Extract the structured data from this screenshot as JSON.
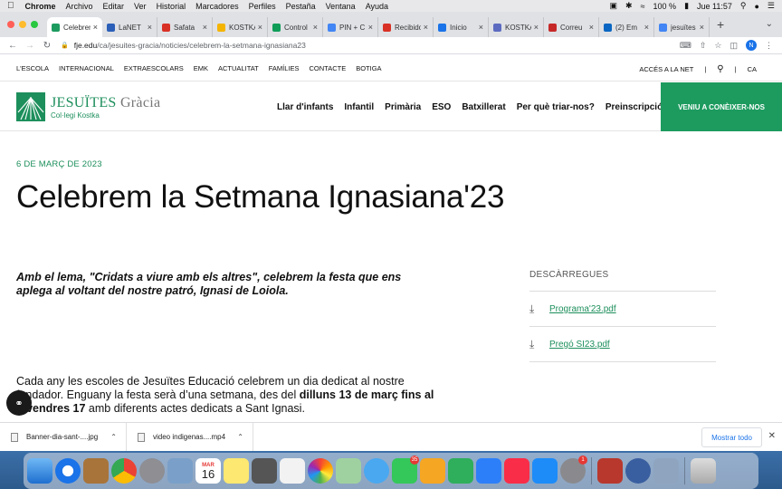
{
  "menubar": {
    "app": "Chrome",
    "items": [
      "Archivo",
      "Editar",
      "Ver",
      "Historial",
      "Marcadores",
      "Perfiles",
      "Pestaña",
      "Ventana",
      "Ayuda"
    ],
    "battery": "100 %",
    "clock": "Jue 11:57"
  },
  "tabs": [
    {
      "label": "Celebrem",
      "color": "#1d9b5f",
      "active": true
    },
    {
      "label": "LaNET",
      "color": "#2b5fb8"
    },
    {
      "label": "Safata",
      "color": "#d93025"
    },
    {
      "label": "KOSTKA",
      "color": "#f4b400"
    },
    {
      "label": "Control",
      "color": "#0f9d58"
    },
    {
      "label": "PIN + C",
      "color": "#4285f4"
    },
    {
      "label": "Recibidos",
      "color": "#d93025"
    },
    {
      "label": "Inicio",
      "color": "#1a73e8"
    },
    {
      "label": "KOSTKA",
      "color": "#5c6bc0"
    },
    {
      "label": "Correu",
      "color": "#c62828"
    },
    {
      "label": "(2) Em",
      "color": "#0a66c2"
    },
    {
      "label": "jesuïtes",
      "color": "#4285f4"
    }
  ],
  "address": {
    "host": "fje.edu",
    "path": "/ca/jesuites-gracia/noticies/celebrem-la-setmana-ignasiana23",
    "avatar": "N"
  },
  "utilnav": {
    "links": [
      "L'ESCOLA",
      "INTERNACIONAL",
      "EXTRAESCOLARS",
      "EMK",
      "ACTUALITAT",
      "FAMÍLIES",
      "CONTACTE",
      "BOTIGA"
    ],
    "login": "ACCÉS A LA NET",
    "lang": "CA"
  },
  "header": {
    "logo_main": "JESUÏTES",
    "logo_place": "Gràcia",
    "logo_sub": "Col·legi Kostka",
    "nav": [
      "Llar d'infants",
      "Infantil",
      "Primària",
      "ESO",
      "Batxillerat",
      "Per què triar-nos?",
      "Preinscripció"
    ],
    "cta": "VENIU A CONÈIXER-NOS"
  },
  "article": {
    "date": "6 DE MARÇ DE 2023",
    "title": "Celebrem la Setmana Ignasiana'23",
    "lead": "Amb el lema, \"Cridats a viure amb els altres\", celebrem la festa que ens aplega al voltant del nostre patró, Ignasi de Loiola.",
    "body_pre": "Cada any les escoles de Jesuïtes Educació celebrem un dia dedicat al nostre fundador. Enguany la festa serà d’una setmana, des del ",
    "body_bold": "dilluns 13 de març fins al divendres 17",
    "body_post": " amb diferents actes dedicats a Sant Ignasi."
  },
  "downloads": {
    "heading": "DESCÀRREGUES",
    "files": [
      " Programa'23.pdf",
      "Pregó SI23.pdf"
    ]
  },
  "shelf": {
    "items": [
      "Banner-dia-sant-....jpg",
      "video indigenas....mp4"
    ],
    "show_all": "Mostrar todo"
  },
  "dock": {
    "calendar_month": "MAR",
    "calendar_day": "16",
    "facetime_badge": "35",
    "settings_badge": "1"
  }
}
